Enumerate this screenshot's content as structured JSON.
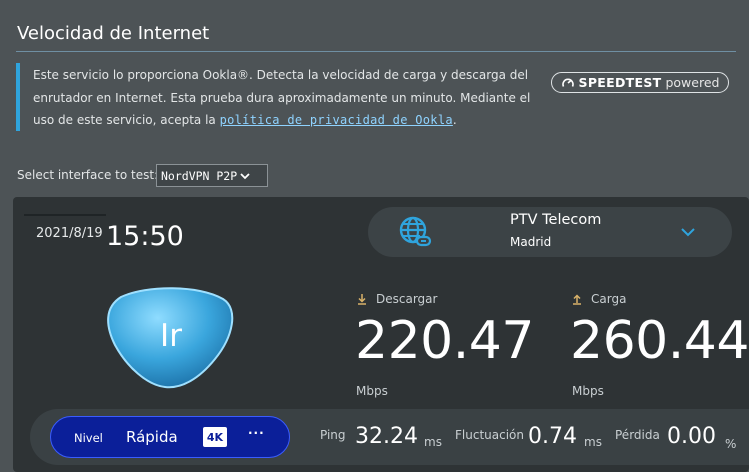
{
  "header": {
    "title": "Velocidad de Internet"
  },
  "notice": {
    "text_before": "Este servicio lo proporciona Ookla®. Detecta la velocidad de carga y descarga del enrutador en Internet. Esta prueba dura aproximadamente un minuto. Mediante el uso de este servicio, acepta la ",
    "link_text": "política de privacidad de Ookla",
    "text_after": "."
  },
  "badge": {
    "brand": "SPEEDTEST",
    "suffix": "powered"
  },
  "interface": {
    "label": "Select interface to test:",
    "selected": "NordVPN P2P"
  },
  "datetime": {
    "date": "2021/8/19",
    "time": "15:50"
  },
  "server": {
    "provider": "PTV Telecom",
    "city": "Madrid"
  },
  "go_button": {
    "label": "Ir"
  },
  "download": {
    "label": "Descargar",
    "value": "220.47",
    "unit": "Mbps"
  },
  "upload": {
    "label": "Carga",
    "value": "260.44",
    "unit": "Mbps"
  },
  "level": {
    "label": "Nivel",
    "value": "Rápida",
    "badge": "4K",
    "more": "···"
  },
  "stats": {
    "ping": {
      "label": "Ping",
      "value": "32.24",
      "unit": "ms"
    },
    "jitter": {
      "label": "Fluctuación",
      "value": "0.74",
      "unit": "ms"
    },
    "loss": {
      "label": "Pérdida",
      "value": "0.00",
      "unit": "%"
    }
  },
  "colors": {
    "accent": "#2fa4dd",
    "link": "#8fd3ff",
    "level_pill": "#0b1f99",
    "go_button": "#3aa6dd"
  },
  "icons": {
    "globe": "globe-link-icon",
    "chevron": "chevron-down-icon",
    "download": "download-arrow-icon",
    "upload": "upload-arrow-icon",
    "speedtest": "speedtest-gauge-icon"
  }
}
